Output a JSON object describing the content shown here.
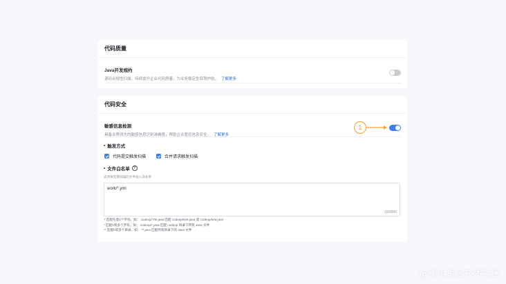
{
  "quality": {
    "header": "代码质量",
    "rule_title": "Java开发规约",
    "rule_desc": "源码合规性扫描，持续提升企业代码质量，为业务稳定性保驾护航。",
    "rule_link": "了解更多",
    "rule_enabled": false
  },
  "security": {
    "header": "代码安全",
    "detect_title": "敏感信息检测",
    "detect_desc": "具备业界领先的敏感信息识别准确度，帮助企业管控信息安全。",
    "detect_link": "了解更多",
    "detect_enabled": true,
    "trigger_title": "触发方式",
    "trigger_options": [
      "代码提交触发扫描",
      "合并请求触发扫描"
    ],
    "whitelist_title": "文件白名单",
    "whitelist_hint": "支持将无需扫描的文件加入白名单",
    "whitelist_value": "work/*.yml",
    "whitelist_counter": "10/3000",
    "rules": [
      "?   匹配任意1个字符。如：  codeup/?/el.java 匹配 codeup/test.java 或 codeup/test.java",
      "*   匹配0或多个字符。如：  codeup/*.java 匹配 codeup 目录下所有 Java 文件",
      "**  匹配0或多个目录。如：  **.java 匹配所有目录下的 Java 文件"
    ]
  },
  "annotation": {
    "number": "1"
  },
  "watermark": "@稀土掘金技术社区",
  "colors": {
    "accent": "#3e7ef0",
    "annotation": "#f0a32e",
    "toggle_off": "#c9ccd1"
  }
}
